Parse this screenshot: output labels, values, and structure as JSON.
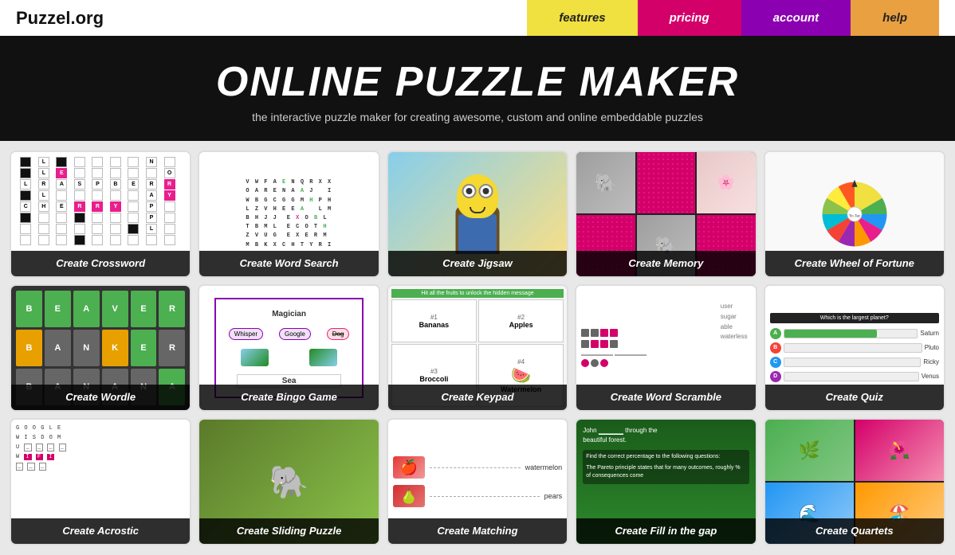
{
  "header": {
    "logo": "Puzzel.org",
    "nav": [
      {
        "label": "features",
        "class": "nav-features"
      },
      {
        "label": "pricing",
        "class": "nav-pricing"
      },
      {
        "label": "account",
        "class": "nav-account"
      },
      {
        "label": "help",
        "class": "nav-help"
      }
    ]
  },
  "hero": {
    "title": "ONLINE PUZZLE MAKER",
    "subtitle": "the interactive puzzle maker for creating awesome, custom and online embeddable puzzles"
  },
  "puzzles": [
    {
      "id": "crossword",
      "label": "Create Crossword"
    },
    {
      "id": "wordsearch",
      "label": "Create Word Search"
    },
    {
      "id": "jigsaw",
      "label": "Create Jigsaw"
    },
    {
      "id": "memory",
      "label": "Create Memory"
    },
    {
      "id": "wheeloffortune",
      "label": "Create Wheel of Fortune"
    },
    {
      "id": "wordle",
      "label": "Create Wordle"
    },
    {
      "id": "bingo",
      "label": "Create Bingo Game"
    },
    {
      "id": "keypad",
      "label": "Create Keypad"
    },
    {
      "id": "wordscramble",
      "label": "Create Word Scramble"
    },
    {
      "id": "quiz",
      "label": "Create Quiz"
    },
    {
      "id": "acrostic",
      "label": "Create Acrostic"
    },
    {
      "id": "sliding",
      "label": "Create Sliding Puzzle"
    },
    {
      "id": "matching",
      "label": "Create Matching"
    },
    {
      "id": "fillgap",
      "label": "Create Fill in the gap"
    },
    {
      "id": "quartets",
      "label": "Create Quartets"
    }
  ],
  "bingo": {
    "words": [
      "Magician",
      "Dog",
      "Sea"
    ],
    "label": "Create Bingo Game"
  },
  "quiz_options": [
    {
      "letter": "A",
      "text": "Saturn"
    },
    {
      "letter": "B",
      "text": "Pluto"
    },
    {
      "letter": "C",
      "text": "Ricky"
    },
    {
      "letter": "D",
      "text": "Venus"
    }
  ]
}
